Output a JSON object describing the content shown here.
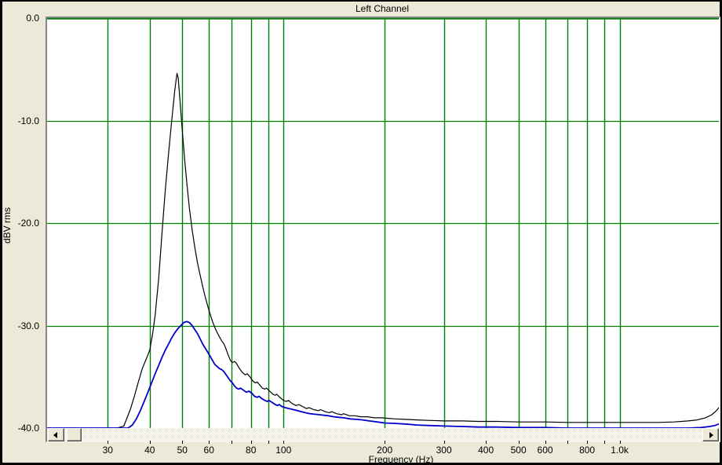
{
  "window": {
    "title": "Left Channel"
  },
  "colors": {
    "frame": "#000000",
    "panel_background": "#ece9d8",
    "plot_background": "#ffffff",
    "grid_green": "#008000",
    "curve_primary_black": "#000000",
    "curve_secondary_blue": "#0000cc",
    "border_gray": "#848484"
  },
  "y_axis": {
    "label": "dBV rms",
    "ticks": [
      "0.0",
      "-10.0",
      "-20.0",
      "-30.0",
      "-40.0"
    ],
    "tick_values": [
      0,
      -10,
      -20,
      -30,
      -40
    ]
  },
  "x_axis": {
    "label": "Frequency (Hz)",
    "labels": [
      {
        "f": 30,
        "text": "30"
      },
      {
        "f": 40,
        "text": "40"
      },
      {
        "f": 50,
        "text": "50"
      },
      {
        "f": 60,
        "text": "60"
      },
      {
        "f": 80,
        "text": "80"
      },
      {
        "f": 100,
        "text": "100"
      },
      {
        "f": 200,
        "text": "200"
      },
      {
        "f": 300,
        "text": "300"
      },
      {
        "f": 400,
        "text": "400"
      },
      {
        "f": 500,
        "text": "500"
      },
      {
        "f": 600,
        "text": "600"
      },
      {
        "f": 800,
        "text": "800"
      },
      {
        "f": 1000,
        "text": "1.0k"
      }
    ],
    "gridline_freqs": [
      30,
      40,
      50,
      60,
      70,
      80,
      90,
      100,
      200,
      300,
      400,
      500,
      600,
      700,
      800,
      900,
      1000
    ]
  },
  "scrollbar": {
    "left_icon": "left-triangle",
    "right_icon": "right-triangle"
  },
  "chart_data": {
    "type": "line",
    "title": "Left Channel",
    "xlabel": "Frequency (Hz)",
    "ylabel": "dBV rms",
    "x_scale": "log",
    "x_range_hz": [
      19.8,
      1973
    ],
    "y_range_db": [
      0,
      -40
    ],
    "grid": true,
    "legend_position": "none",
    "series": [
      {
        "name": "spectrum-trace-black",
        "color_key": "curve_primary_black",
        "peak": {
          "f": 48,
          "db": -5.4
        },
        "points": [
          [
            19.8,
            -40
          ],
          [
            24,
            -40
          ],
          [
            28,
            -40
          ],
          [
            32,
            -40
          ],
          [
            33.5,
            -39.8
          ],
          [
            35,
            -38.2
          ],
          [
            36,
            -36.9
          ],
          [
            37,
            -35.5
          ],
          [
            38,
            -34.2
          ],
          [
            39,
            -33.3
          ],
          [
            40,
            -32.4
          ],
          [
            40.8,
            -30.8
          ],
          [
            41.5,
            -29
          ],
          [
            42.5,
            -25.5
          ],
          [
            43.5,
            -21
          ],
          [
            44.5,
            -16.8
          ],
          [
            45.5,
            -13.2
          ],
          [
            46.5,
            -10
          ],
          [
            47.5,
            -7
          ],
          [
            48.2,
            -5.4
          ],
          [
            48.6,
            -5.8
          ],
          [
            49.2,
            -8
          ],
          [
            50,
            -11
          ],
          [
            50.8,
            -13.8
          ],
          [
            51.6,
            -16.2
          ],
          [
            52.5,
            -18.6
          ],
          [
            53.5,
            -20.7
          ],
          [
            54.5,
            -22.4
          ],
          [
            55.5,
            -23.9
          ],
          [
            56.5,
            -25.1
          ],
          [
            57.5,
            -26.2
          ],
          [
            58.5,
            -27.2
          ],
          [
            59.5,
            -28.1
          ],
          [
            60.5,
            -28.9
          ],
          [
            61.5,
            -29.6
          ],
          [
            62.5,
            -30.2
          ],
          [
            63.5,
            -30.7
          ],
          [
            64.5,
            -31.1
          ],
          [
            65.5,
            -31.5
          ],
          [
            66.5,
            -31.8
          ],
          [
            67.5,
            -32.3
          ],
          [
            68.5,
            -32.9
          ],
          [
            69.5,
            -33.4
          ],
          [
            70.5,
            -33.6
          ],
          [
            71.5,
            -33.5
          ],
          [
            72.5,
            -33.7
          ],
          [
            74,
            -34.2
          ],
          [
            75.5,
            -34.6
          ],
          [
            77,
            -34.8
          ],
          [
            78,
            -34.7
          ],
          [
            79.5,
            -35.0
          ],
          [
            81,
            -35.4
          ],
          [
            82.5,
            -35.6
          ],
          [
            83.5,
            -35.5
          ],
          [
            85,
            -35.8
          ],
          [
            86.5,
            -36.1
          ],
          [
            88,
            -36.2
          ],
          [
            89,
            -36.1
          ],
          [
            91,
            -36.4
          ],
          [
            93,
            -36.7
          ],
          [
            94.5,
            -36.8
          ],
          [
            95.5,
            -36.7
          ],
          [
            97.5,
            -37.0
          ],
          [
            100,
            -37.3
          ],
          [
            102,
            -37.4
          ],
          [
            103.5,
            -37.3
          ],
          [
            106,
            -37.6
          ],
          [
            109,
            -37.8
          ],
          [
            111,
            -37.7
          ],
          [
            114,
            -37.9
          ],
          [
            117,
            -38.1
          ],
          [
            119,
            -38.0
          ],
          [
            123,
            -38.2
          ],
          [
            127,
            -38.3
          ],
          [
            129,
            -38.2
          ],
          [
            133,
            -38.4
          ],
          [
            137,
            -38.5
          ],
          [
            139,
            -38.4
          ],
          [
            144,
            -38.6
          ],
          [
            149,
            -38.7
          ],
          [
            151,
            -38.6
          ],
          [
            157,
            -38.8
          ],
          [
            163,
            -38.8
          ],
          [
            170,
            -38.9
          ],
          [
            178,
            -38.9
          ],
          [
            186,
            -39.0
          ],
          [
            195,
            -39.0
          ],
          [
            205,
            -39.05
          ],
          [
            215,
            -39.1
          ],
          [
            230,
            -39.15
          ],
          [
            250,
            -39.2
          ],
          [
            270,
            -39.25
          ],
          [
            300,
            -39.3
          ],
          [
            340,
            -39.3
          ],
          [
            380,
            -39.35
          ],
          [
            430,
            -39.35
          ],
          [
            500,
            -39.4
          ],
          [
            600,
            -39.4
          ],
          [
            700,
            -39.45
          ],
          [
            800,
            -39.45
          ],
          [
            900,
            -39.45
          ],
          [
            1000,
            -39.45
          ],
          [
            1150,
            -39.45
          ],
          [
            1300,
            -39.45
          ],
          [
            1450,
            -39.4
          ],
          [
            1600,
            -39.3
          ],
          [
            1700,
            -39.2
          ],
          [
            1800,
            -39.0
          ],
          [
            1880,
            -38.7
          ],
          [
            1940,
            -38.3
          ],
          [
            1973,
            -38.0
          ]
        ]
      },
      {
        "name": "spectrum-trace-blue",
        "color_key": "curve_secondary_blue",
        "peak": {
          "f": 51,
          "db": -29.6
        },
        "points": [
          [
            19.8,
            -40
          ],
          [
            25,
            -40
          ],
          [
            30,
            -40
          ],
          [
            34.5,
            -40
          ],
          [
            35.5,
            -39.7
          ],
          [
            36.5,
            -39.1
          ],
          [
            37.5,
            -38.3
          ],
          [
            38.5,
            -37.4
          ],
          [
            39.5,
            -36.5
          ],
          [
            40.5,
            -35.6
          ],
          [
            41.5,
            -34.7
          ],
          [
            42.5,
            -33.9
          ],
          [
            43.5,
            -33.1
          ],
          [
            44.5,
            -32.4
          ],
          [
            45.5,
            -31.8
          ],
          [
            46.5,
            -31.2
          ],
          [
            47.5,
            -30.7
          ],
          [
            48.5,
            -30.3
          ],
          [
            49.5,
            -30.0
          ],
          [
            50.5,
            -29.7
          ],
          [
            51.5,
            -29.6
          ],
          [
            52.5,
            -29.7
          ],
          [
            53.5,
            -30.0
          ],
          [
            54.5,
            -30.4
          ],
          [
            55.5,
            -30.8
          ],
          [
            56.5,
            -31.3
          ],
          [
            57.5,
            -31.8
          ],
          [
            58.5,
            -32.2
          ],
          [
            59.5,
            -32.6
          ],
          [
            60.5,
            -33.0
          ],
          [
            61.5,
            -33.4
          ],
          [
            62.5,
            -33.8
          ],
          [
            63.5,
            -34.0
          ],
          [
            64.5,
            -34.2
          ],
          [
            65.5,
            -34.3
          ],
          [
            66.5,
            -34.5
          ],
          [
            67.5,
            -34.8
          ],
          [
            68.5,
            -35.1
          ],
          [
            69.5,
            -35.4
          ],
          [
            70.5,
            -35.6
          ],
          [
            71.5,
            -35.9
          ],
          [
            72.5,
            -36.1
          ],
          [
            73.5,
            -36.2
          ],
          [
            74.5,
            -36.1
          ],
          [
            76,
            -36.3
          ],
          [
            77.5,
            -36.5
          ],
          [
            79,
            -36.4
          ],
          [
            80.5,
            -36.6
          ],
          [
            82,
            -36.9
          ],
          [
            83.5,
            -37.0
          ],
          [
            84.5,
            -36.9
          ],
          [
            86,
            -37.1
          ],
          [
            88,
            -37.3
          ],
          [
            89.5,
            -37.4
          ],
          [
            90.5,
            -37.3
          ],
          [
            92.5,
            -37.5
          ],
          [
            94.5,
            -37.7
          ],
          [
            96,
            -37.8
          ],
          [
            97,
            -37.7
          ],
          [
            99,
            -37.9
          ],
          [
            101,
            -38.0
          ],
          [
            104,
            -38.1
          ],
          [
            107,
            -38.2
          ],
          [
            110,
            -38.3
          ],
          [
            113,
            -38.4
          ],
          [
            116,
            -38.5
          ],
          [
            120,
            -38.6
          ],
          [
            124,
            -38.65
          ],
          [
            128,
            -38.7
          ],
          [
            132,
            -38.75
          ],
          [
            136,
            -38.8
          ],
          [
            141,
            -38.9
          ],
          [
            146,
            -38.95
          ],
          [
            151,
            -39.0
          ],
          [
            158,
            -39.1
          ],
          [
            165,
            -39.15
          ],
          [
            172,
            -39.2
          ],
          [
            180,
            -39.3
          ],
          [
            190,
            -39.4
          ],
          [
            200,
            -39.5
          ],
          [
            215,
            -39.55
          ],
          [
            230,
            -39.6
          ],
          [
            250,
            -39.7
          ],
          [
            270,
            -39.75
          ],
          [
            300,
            -39.8
          ],
          [
            340,
            -39.85
          ],
          [
            380,
            -39.9
          ],
          [
            430,
            -39.9
          ],
          [
            500,
            -39.95
          ],
          [
            600,
            -39.95
          ],
          [
            700,
            -40
          ],
          [
            850,
            -40
          ],
          [
            1000,
            -40
          ],
          [
            1200,
            -40
          ],
          [
            1400,
            -40
          ],
          [
            1600,
            -40
          ],
          [
            1750,
            -39.95
          ],
          [
            1850,
            -39.85
          ],
          [
            1920,
            -39.75
          ],
          [
            1973,
            -39.6
          ]
        ]
      }
    ]
  }
}
